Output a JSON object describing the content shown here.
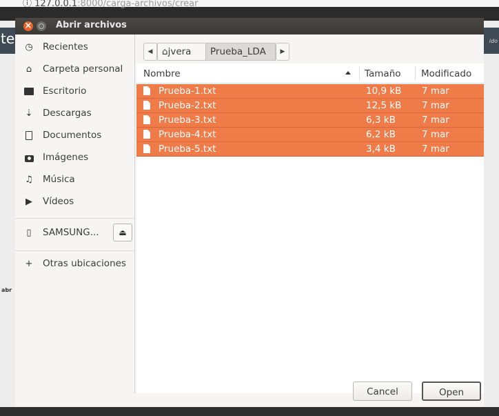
{
  "browser": {
    "url_host": "127.0.0.1",
    "url_rest": ":8000/carga-archivos/crear",
    "left_text": "te",
    "left_small": "abr",
    "right_text": "ido"
  },
  "dialog": {
    "title": "Abrir archivos"
  },
  "sidebar": {
    "items": [
      {
        "label": "Recientes",
        "icon": "clock-icon"
      },
      {
        "label": "Carpeta personal",
        "icon": "home-icon"
      },
      {
        "label": "Escritorio",
        "icon": "desktop-folder-icon"
      },
      {
        "label": "Descargas",
        "icon": "download-icon"
      },
      {
        "label": "Documentos",
        "icon": "document-icon"
      },
      {
        "label": "Imágenes",
        "icon": "camera-icon"
      },
      {
        "label": "Música",
        "icon": "music-icon"
      },
      {
        "label": "Vídeos",
        "icon": "video-icon"
      }
    ],
    "device": {
      "label": "SAMSUNG...",
      "icon": "usb-drive-icon",
      "eject_icon": "eject-icon"
    },
    "other": {
      "label": "Otras ubicaciones",
      "icon": "plus-icon"
    }
  },
  "pathbar": {
    "segments": [
      {
        "label": "jvera",
        "icon": "home-icon"
      },
      {
        "label": "Prueba_LDA"
      }
    ]
  },
  "columns": {
    "name": "Nombre",
    "size": "Tamaño",
    "modified": "Modificado"
  },
  "files": [
    {
      "name": "Prueba-1.txt",
      "size": "10,9 kB",
      "modified": "7 mar"
    },
    {
      "name": "Prueba-2.txt",
      "size": "12,5 kB",
      "modified": "7 mar"
    },
    {
      "name": "Prueba-3.txt",
      "size": "6,3 kB",
      "modified": "7 mar"
    },
    {
      "name": "Prueba-4.txt",
      "size": "6,2 kB",
      "modified": "7 mar"
    },
    {
      "name": "Prueba-5.txt",
      "size": "3,4 kB",
      "modified": "7 mar"
    }
  ],
  "buttons": {
    "cancel": "Cancel",
    "open": "Open"
  },
  "colors": {
    "selection": "#ef7b49",
    "titlebar": "#3d3c39",
    "close_button": "#e8632b"
  }
}
